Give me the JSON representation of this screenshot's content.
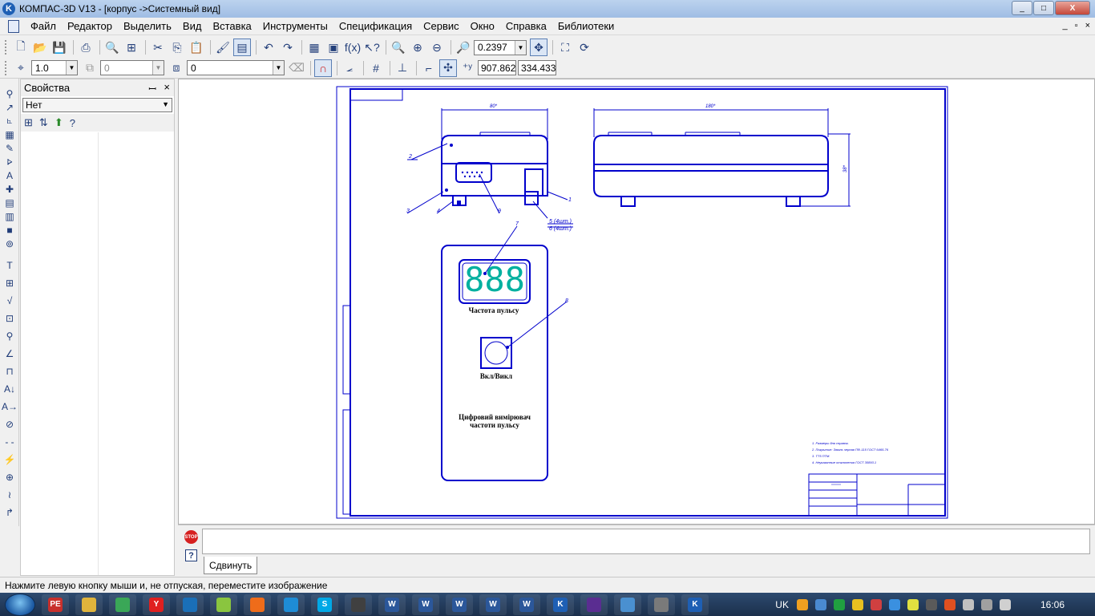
{
  "window": {
    "logo": "K",
    "title": "КОМПАС-3D V13 - [корпус ->Системный вид]",
    "min": "_",
    "max": "□",
    "close": "X"
  },
  "menu": {
    "items": [
      "Файл",
      "Редактор",
      "Выделить",
      "Вид",
      "Вставка",
      "Инструменты",
      "Спецификация",
      "Сервис",
      "Окно",
      "Справка",
      "Библиотеки"
    ],
    "mdi_controls": [
      "_",
      "▫",
      "×"
    ]
  },
  "toolbar1": {
    "zoom_value": "0.2397"
  },
  "toolbar2": {
    "line_scale": "1.0",
    "layer_value": "0",
    "style_value": "0",
    "coord_x": "907.862",
    "coord_y": "334.433"
  },
  "properties_panel": {
    "title": "Свойства",
    "pin": "ꟷ",
    "close": "×",
    "selector_value": "Нет"
  },
  "drawing": {
    "dim_width_top": "80*",
    "dim_length_top": "180*",
    "dim_height": "38*",
    "leaders": [
      "1",
      "2",
      "3",
      "4",
      "5 (4шт.)",
      "6 (4шт.)",
      "7",
      "8",
      "9"
    ],
    "display_digits": "888",
    "display_label": "Частота пульсу",
    "button_label": "Вкл/Викл",
    "device_title_line1": "Цифровий вимірювач",
    "device_title_line2": "частоти пульсу",
    "notes": [
      "1. Размеры для справок.",
      "2. Покрытие: Эмаль черная ПФ-115 ГОСТ 6465-76",
      "3. ТТ5 ПТМ.",
      "4. Неуказанные отклонения ГОСТ 30893.1"
    ]
  },
  "command_panel": {
    "stop_label": "STOP",
    "help_label": "?",
    "tab_label": "Сдвинуть"
  },
  "statusbar": {
    "text": "Нажмите левую кнопку мыши и, не отпуская, переместите изображение"
  },
  "taskbar": {
    "language": "UK",
    "clock": "16:06",
    "apps": [
      {
        "name": "PE",
        "color": "#c8302c"
      },
      {
        "name": "",
        "color": "#e0b43c"
      },
      {
        "name": "",
        "color": "#3aa757"
      },
      {
        "name": "Y",
        "color": "#e02020"
      },
      {
        "name": "",
        "color": "#1a6fb8"
      },
      {
        "name": "",
        "color": "#8ac53f"
      },
      {
        "name": "",
        "color": "#ef6c1a"
      },
      {
        "name": "",
        "color": "#1e8cd6"
      },
      {
        "name": "S",
        "color": "#00a8e6"
      },
      {
        "name": "",
        "color": "#404040"
      },
      {
        "name": "W",
        "color": "#2b579a"
      },
      {
        "name": "W",
        "color": "#2b579a"
      },
      {
        "name": "W",
        "color": "#2b579a"
      },
      {
        "name": "W",
        "color": "#2b579a"
      },
      {
        "name": "W",
        "color": "#2b579a"
      },
      {
        "name": "K",
        "color": "#1e5fb4"
      },
      {
        "name": "",
        "color": "#5a2d91"
      },
      {
        "name": "",
        "color": "#4a90d0"
      },
      {
        "name": "",
        "color": "#7a7a7a"
      },
      {
        "name": "K",
        "color": "#1e5fb4"
      }
    ]
  },
  "colors": {
    "drawing_line": "#0000cc",
    "display_digit": "#00b0a0"
  }
}
